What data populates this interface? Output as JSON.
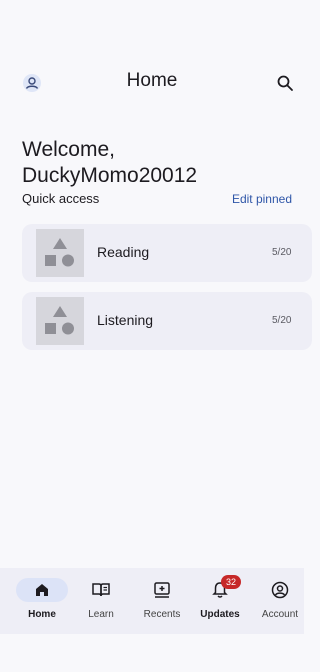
{
  "app_bar": {
    "title": "Home",
    "account_icon": "account-circle-icon",
    "search_icon": "search-icon"
  },
  "welcome": {
    "line1": "Welcome,",
    "line2": "DuckyMomo20012"
  },
  "quick_access": {
    "label": "Quick access",
    "edit_label": "Edit pinned",
    "items": [
      {
        "name": "Reading",
        "progress": "5/20",
        "thumb_icon": "shapes-placeholder-icon"
      },
      {
        "name": "Listening",
        "progress": "5/20",
        "thumb_icon": "shapes-placeholder-icon"
      }
    ]
  },
  "bottom_nav": {
    "items": [
      {
        "label": "Home",
        "icon": "home-icon",
        "active": true
      },
      {
        "label": "Learn",
        "icon": "book-icon",
        "active": false
      },
      {
        "label": "Recents",
        "icon": "recents-icon",
        "active": false
      },
      {
        "label": "Updates",
        "icon": "bell-icon",
        "active": false,
        "badge": "32"
      },
      {
        "label": "Account",
        "icon": "account-circle-icon",
        "active": false
      }
    ]
  },
  "colors": {
    "background": "#f8f8fb",
    "accent": "#2f56a8",
    "card": "#eeeef6",
    "badge": "#c62828"
  }
}
